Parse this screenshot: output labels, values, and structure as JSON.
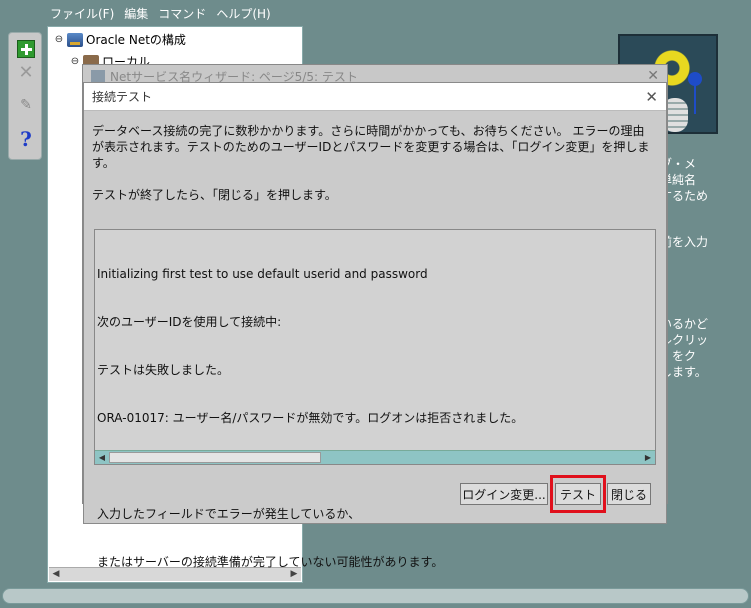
{
  "menubar": {
    "items": [
      "ファイル(F)",
      "編集",
      "コマンド",
      "ヘルプ(H)"
    ]
  },
  "toolbar": {
    "add_icon": "plus-icon",
    "delete_icon": "x-icon",
    "edit_icon": "edit-icon",
    "help_label": "?"
  },
  "tree": {
    "root_label": "Oracle Netの構成",
    "child_label": "ローカル"
  },
  "right_help": {
    "line1": "ブ・メ",
    "line2": "単純名",
    "line3": "するため",
    "line4": "前を入力",
    "line5": "いるかど",
    "line6": "ルクリッ",
    "line7": "」をク",
    "line8": "します。",
    "line9": "」"
  },
  "wizard": {
    "title": "Netサービス名ウィザード: ページ5/5: テスト"
  },
  "dialog": {
    "title": "接続テスト",
    "instructions_1": "データベース接続の完了に数秒かかります。さらに時間がかかっても、お待ちください。 エラーの理由",
    "instructions_2": "が表示されます。テストのためのユーザーIDとパスワードを変更する場合は、「ログイン変更」を押しま",
    "instructions_3": "す。",
    "instructions_4": "テストが終了したら、「閉じる」を押します。",
    "result_lines": [
      "Initializing first test to use default userid and password",
      "次のユーザーIDを使用して接続中:",
      "テストは失敗しました。",
      "ORA-01017: ユーザー名/パスワードが無効です。ログオンは拒否されました。",
      "",
      "入力したフィールドでエラーが発生しているか、",
      "またはサーバーの接続準備が完了していない可能性があります。"
    ],
    "buttons": {
      "login_change": "ログイン変更...",
      "test": "テスト",
      "close": "閉じる"
    }
  },
  "colors": {
    "background": "#6e8c8c",
    "highlight": "#e0101c"
  }
}
